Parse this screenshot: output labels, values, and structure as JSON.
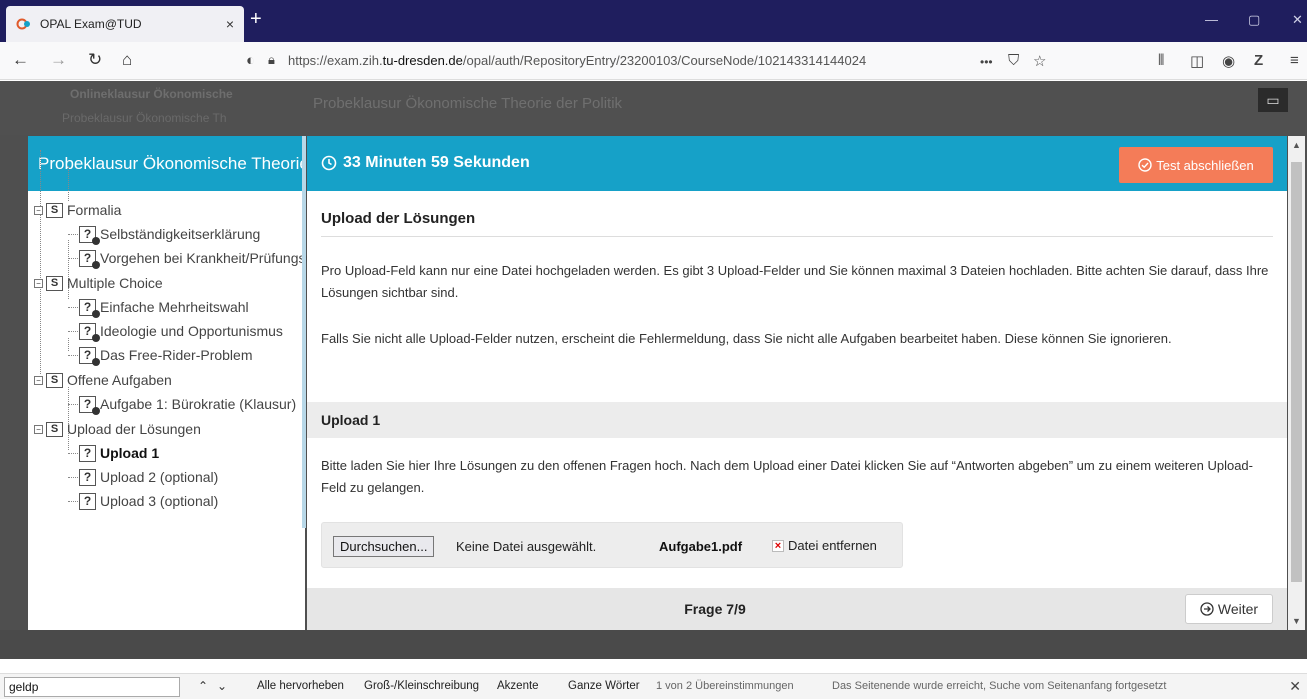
{
  "browser": {
    "tab_title": "OPAL Exam@TUD",
    "tab_close": "×",
    "new_tab": "+",
    "url_prefix": "https://exam.zih.",
    "url_domain": "tu-dresden.de",
    "url_path": "/opal/auth/RepositoryEntry/23200103/CourseNode/102143314144024",
    "more": "•••",
    "win_min": "—",
    "win_max": "▢",
    "win_close": "✕"
  },
  "background": {
    "crumb1": "Onlineklausur Ökonomische",
    "crumb2": "Probeklausur Ökonomische Th",
    "title": "Probeklausur Ökonomische Theorie der Politik"
  },
  "sidebar": {
    "header": "Probeklausur Ökonomische Theorie der Politik",
    "items": [
      {
        "type": "section",
        "label": "Formalia"
      },
      {
        "type": "question",
        "label": "Selbständigkeitserklärung"
      },
      {
        "type": "question",
        "label": "Vorgehen bei Krankheit/Prüfungsunfähigkeit"
      },
      {
        "type": "section",
        "label": "Multiple Choice"
      },
      {
        "type": "question",
        "label": "Einfache Mehrheitswahl"
      },
      {
        "type": "question",
        "label": "Ideologie und Opportunismus"
      },
      {
        "type": "question",
        "label": "Das Free-Rider-Problem"
      },
      {
        "type": "section",
        "label": "Offene Aufgaben"
      },
      {
        "type": "question",
        "label": "Aufgabe 1: Bürokratie (Klausur)"
      },
      {
        "type": "section",
        "label": "Upload der Lösungen"
      },
      {
        "type": "upload",
        "label": "Upload 1"
      },
      {
        "type": "upload",
        "label": "Upload 2 (optional)"
      },
      {
        "type": "upload",
        "label": "Upload 3 (optional)"
      }
    ]
  },
  "main": {
    "timer": "33 Minuten 59 Sekunden",
    "finish_button": "Test abschließen",
    "section_title": "Upload der Lösungen",
    "para1": "Pro Upload-Feld kann nur eine Datei hochgeladen werden. Es gibt 3 Upload-Felder und Sie können maximal 3 Dateien hochladen. Bitte achten Sie darauf, dass Ihre Lösungen sichtbar sind.",
    "para2": "Falls Sie nicht alle Upload-Felder nutzen, erscheint die Fehlermeldung, dass Sie nicht alle Aufgaben bearbeitet haben. Diese können Sie ignorieren.",
    "upload_title": "Upload 1",
    "upload_text": "Bitte laden Sie hier Ihre Lösungen zu den offenen Fragen hoch. Nach dem Upload einer Datei klicken Sie auf “Antworten abgeben” um zu einem weiteren Upload-Feld zu gelangen.",
    "browse_button": "Durchsuchen...",
    "no_file": "Keine Datei ausgewählt.",
    "file_name": "Aufgabe1.pdf",
    "remove_file": "Datei entfernen",
    "question_counter": "Frage 7/9",
    "next_button": "Weiter"
  },
  "findbar": {
    "query": "geldp",
    "prev": "⌃",
    "next": "⌄",
    "highlight_all": "Alle hervorheben",
    "match_case": "Groß-/Kleinschreibung",
    "match_diacritics": "Akzente",
    "whole_words": "Ganze Wörter",
    "match_count": "1 von 2 Übereinstimmungen",
    "status": "Das Seitenende wurde erreicht, Suche vom Seitenanfang fortgesetzt",
    "close": "✕"
  },
  "colors": {
    "accent": "#16a1c8",
    "finish": "#f47c58",
    "tabbar": "#1f1e5e"
  }
}
